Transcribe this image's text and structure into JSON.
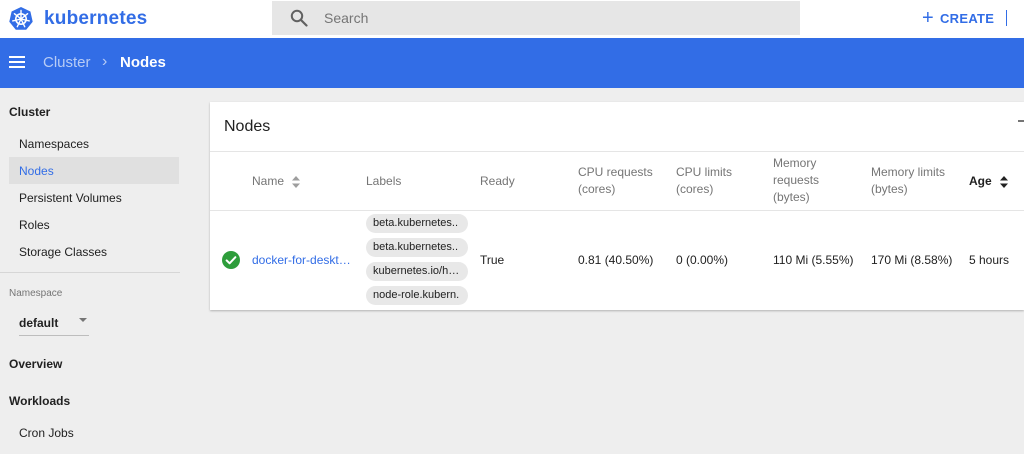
{
  "brand": {
    "name": "kubernetes",
    "color": "#326de6"
  },
  "search": {
    "placeholder": "Search"
  },
  "header": {
    "create_label": "CREATE"
  },
  "breadcrumb": {
    "parent": "Cluster",
    "separator": "›",
    "current": "Nodes"
  },
  "sidebar": {
    "cluster_heading": "Cluster",
    "cluster_items": [
      {
        "label": "Namespaces",
        "active": false
      },
      {
        "label": "Nodes",
        "active": true
      },
      {
        "label": "Persistent Volumes",
        "active": false
      },
      {
        "label": "Roles",
        "active": false
      },
      {
        "label": "Storage Classes",
        "active": false
      }
    ],
    "namespace_label": "Namespace",
    "namespace_value": "default",
    "overview_heading": "Overview",
    "workloads_heading": "Workloads",
    "workload_items": [
      {
        "label": "Cron Jobs"
      }
    ]
  },
  "card": {
    "title": "Nodes",
    "columns": {
      "name": "Name",
      "labels": "Labels",
      "ready": "Ready",
      "cpu_requests": [
        "CPU requests",
        "(cores)"
      ],
      "cpu_limits": [
        "CPU limits",
        "(cores)"
      ],
      "memory_requests": [
        "Memory",
        "requests",
        "(bytes)"
      ],
      "memory_limits": [
        "Memory limits",
        "(bytes)"
      ],
      "age": "Age"
    },
    "rows": [
      {
        "status": "ok",
        "name": "docker-for-deskt…",
        "labels": [
          "beta.kubernetes..",
          "beta.kubernetes..",
          "kubernetes.io/h…",
          "node-role.kubern."
        ],
        "ready": "True",
        "cpu_requests": "0.81 (40.50%)",
        "cpu_limits": "0 (0.00%)",
        "memory_requests": "110 Mi (5.55%)",
        "memory_limits": "170 Mi (8.58%)",
        "age": "5 hours"
      }
    ]
  },
  "icons": {
    "logo": "kubernetes-wheel-icon",
    "search": "search-icon",
    "create": "plus-icon",
    "menu": "hamburger-menu-icon",
    "sort": "sort-icon",
    "status": "check-circle-icon",
    "dropdown": "caret-down-icon"
  },
  "colors": {
    "primary": "#326de6",
    "success": "#2e9d3b",
    "chip_bg": "#e8e8e8"
  }
}
